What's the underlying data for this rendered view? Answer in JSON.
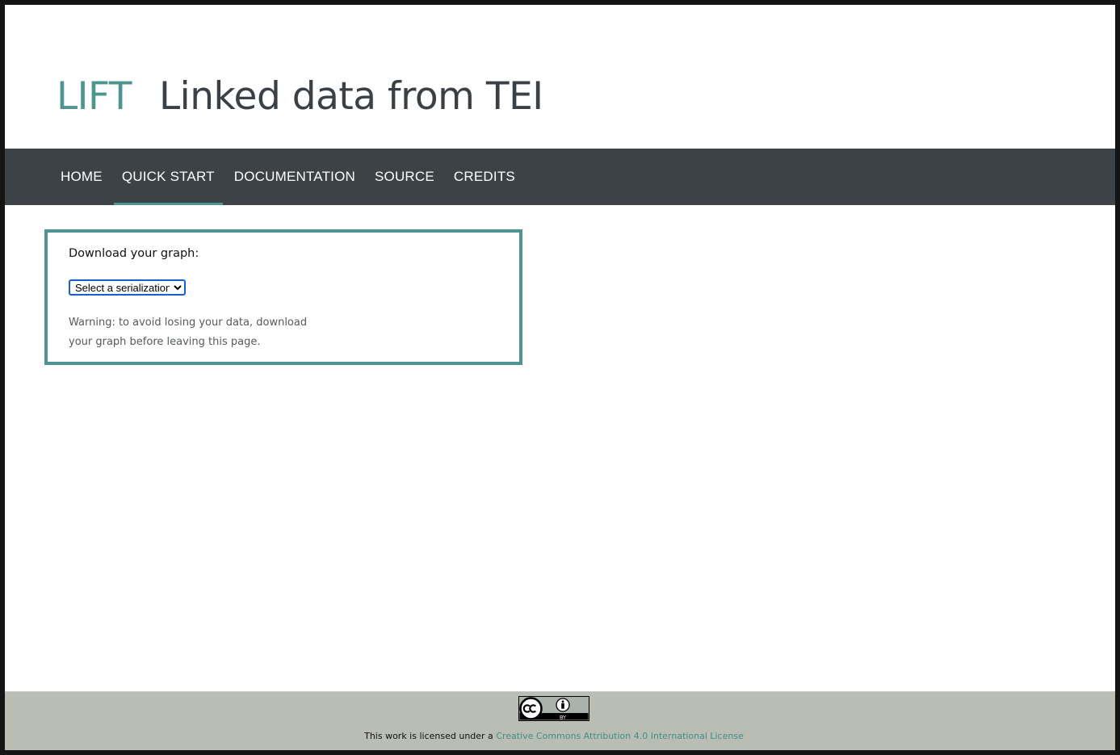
{
  "header": {
    "brand": "LIFT",
    "tagline": "Linked data from TEI"
  },
  "nav": {
    "items": [
      {
        "label": "HOME",
        "active": false
      },
      {
        "label": "QUICK START",
        "active": true
      },
      {
        "label": "DOCUMENTATION",
        "active": false
      },
      {
        "label": "SOURCE",
        "active": false
      },
      {
        "label": "CREDITS",
        "active": false
      }
    ]
  },
  "panel": {
    "heading": "Download your graph:",
    "select": {
      "selected": "Select a serialization",
      "options": [
        "Select a serialization"
      ]
    },
    "warning": "Warning: to avoid losing your data, download your graph before leaving this page."
  },
  "footer": {
    "license_prefix": "This work is licensed under a ",
    "license_link": "Creative Commons Attribution 4.0 International License",
    "badge_icon": "cc-by-icon"
  },
  "colors": {
    "accent": "#4e9590",
    "navbar": "#3c4245",
    "footer": "#b9bdb4",
    "title": "#3b4044"
  }
}
